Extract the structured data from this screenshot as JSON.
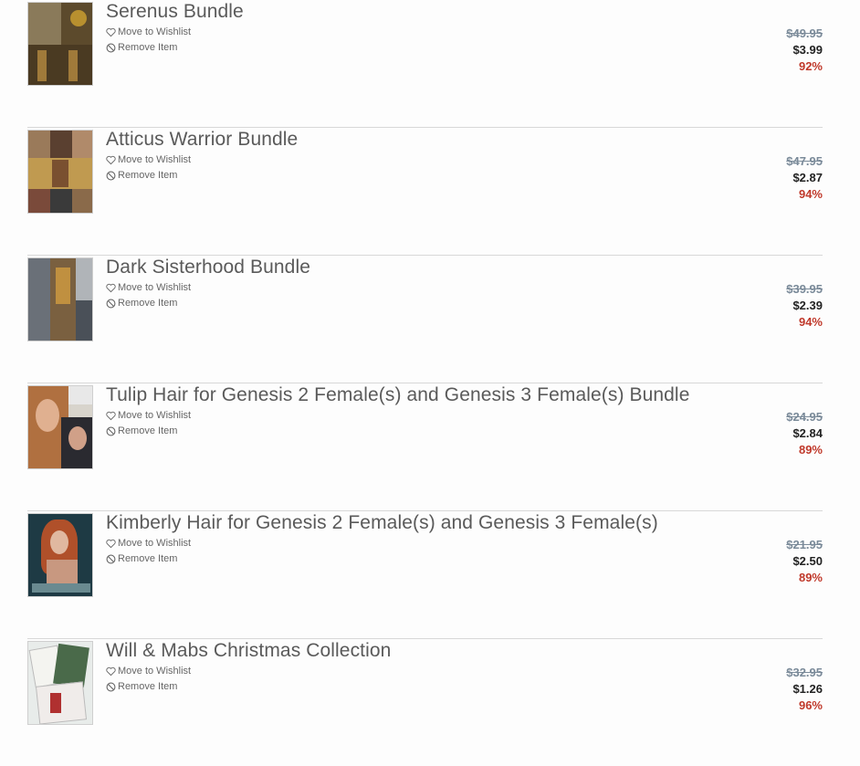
{
  "actions": {
    "wishlist_label": "Move to Wishlist",
    "remove_label": "Remove Item"
  },
  "colors": {
    "discount": "#c0392b",
    "old_price": "#7a8a99",
    "divider": "#d8d8d8"
  },
  "items": [
    {
      "name": "Serenus Bundle",
      "old_price": "$49.95",
      "price": "$3.99",
      "discount": "92%"
    },
    {
      "name": "Atticus Warrior Bundle",
      "old_price": "$47.95",
      "price": "$2.87",
      "discount": "94%"
    },
    {
      "name": "Dark Sisterhood Bundle",
      "old_price": "$39.95",
      "price": "$2.39",
      "discount": "94%"
    },
    {
      "name": "Tulip Hair for Genesis 2 Female(s) and Genesis 3 Female(s) Bundle",
      "old_price": "$24.95",
      "price": "$2.84",
      "discount": "89%"
    },
    {
      "name": "Kimberly Hair for Genesis 2 Female(s) and Genesis 3 Female(s)",
      "old_price": "$21.95",
      "price": "$2.50",
      "discount": "89%"
    },
    {
      "name": "Will & Mabs Christmas Collection",
      "old_price": "$32.95",
      "price": "$1.26",
      "discount": "96%"
    }
  ]
}
